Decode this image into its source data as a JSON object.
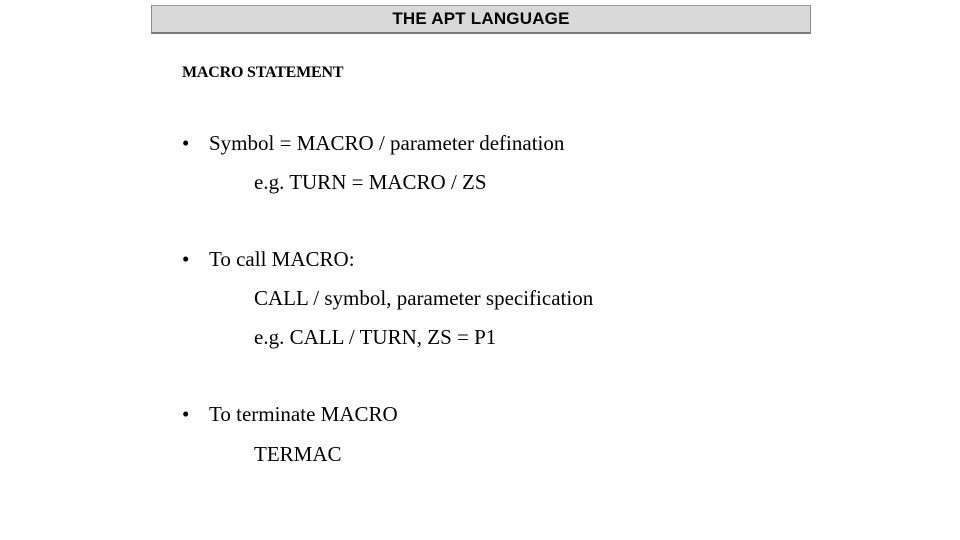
{
  "header": {
    "title": "THE APT LANGUAGE"
  },
  "section": {
    "heading": "MACRO STATEMENT"
  },
  "bullets": [
    {
      "marker": "•",
      "text": "Symbol = MACRO / parameter defination",
      "sub_lines": [
        "e.g. TURN = MACRO / ZS"
      ]
    },
    {
      "marker": "•",
      "text": "To call MACRO:",
      "sub_lines": [
        "CALL / symbol, parameter specification",
        "e.g. CALL / TURN, ZS = P1"
      ]
    },
    {
      "marker": "•",
      "text": "To terminate MACRO",
      "sub_lines": [
        "TERMAC"
      ]
    }
  ],
  "colors": {
    "header_fill": "#d9d9d9",
    "header_border": "#808080",
    "text": "#000000",
    "background": "#ffffff"
  }
}
